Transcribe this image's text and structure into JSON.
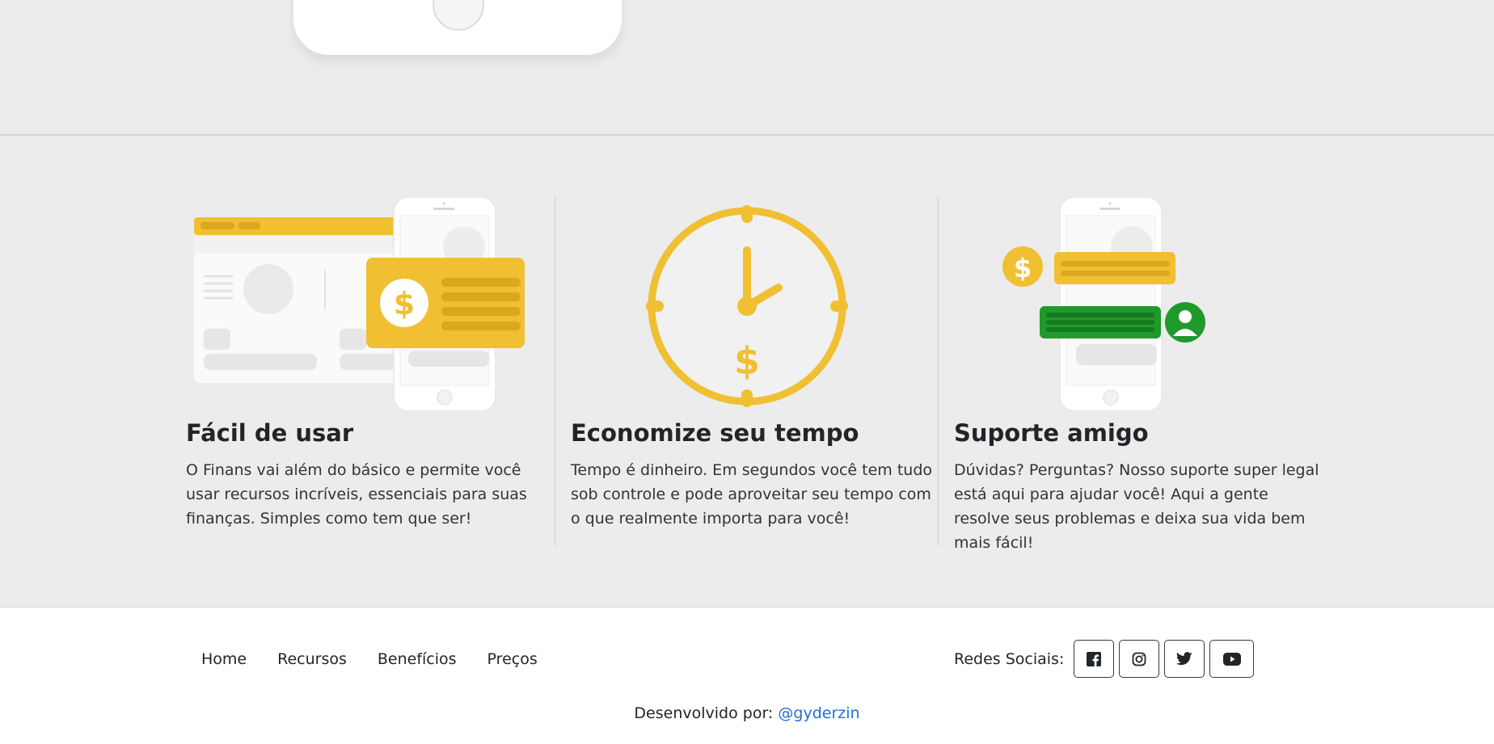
{
  "features": [
    {
      "title": "Fácil de usar",
      "text": "O Finans vai além do básico e permite você usar recursos incríveis, essenciais para suas finanças. Simples como tem que ser!"
    },
    {
      "title": "Economize seu tempo",
      "text": "Tempo é dinheiro. Em segundos você tem tudo sob controle e pode aproveitar seu tempo com o que realmente importa para você!"
    },
    {
      "title": "Suporte amigo",
      "text": "Dúvidas? Perguntas? Nosso suporte super legal está aqui para ajudar você! Aqui a gente resolve seus problemas e deixa sua vida bem mais fácil!"
    }
  ],
  "footer": {
    "nav": [
      "Home",
      "Recursos",
      "Benefícios",
      "Preços"
    ],
    "social_label": "Redes Sociais:",
    "social_icons": [
      "facebook-icon",
      "instagram-icon",
      "twitter-icon",
      "youtube-icon"
    ],
    "credit_prefix": "Desenvolvido por:",
    "credit_handle": "@gyderzin"
  },
  "colors": {
    "accent_yellow": "#f0bf32",
    "accent_green": "#1f9a2a",
    "link_blue": "#1e6fd9",
    "background": "#ececec"
  }
}
